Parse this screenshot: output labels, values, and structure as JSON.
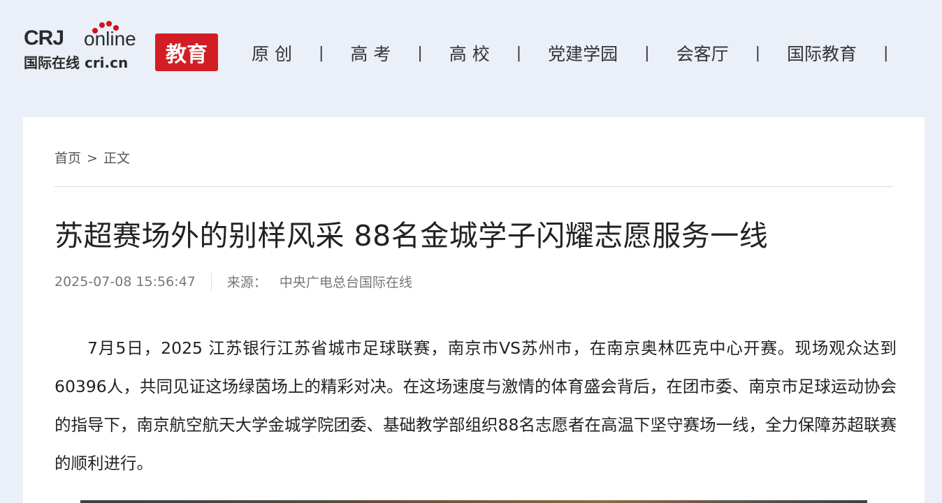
{
  "header": {
    "logo": {
      "brand": "CRJ",
      "online": "online",
      "subtitle": "国际在线 cri.cn",
      "badge": "教育"
    },
    "nav": [
      {
        "label": "原 创"
      },
      {
        "label": "高 考"
      },
      {
        "label": "高 校"
      },
      {
        "label": "党建学园"
      },
      {
        "label": "会客厅"
      },
      {
        "label": "国际教育"
      }
    ],
    "nav_separator": "|"
  },
  "breadcrumb": {
    "home": "首页",
    "separator": ">",
    "current": "正文"
  },
  "article": {
    "title": "苏超赛场外的别样风采 88名金城学子闪耀志愿服务一线",
    "datetime": "2025-07-08 15:56:47",
    "source_label": "来源：",
    "source_name": "中央广电总台国际在线",
    "paragraph": "7月5日，2025 江苏银行江苏省城市足球联赛，南京市VS苏州市，在南京奥林匹克中心开赛。现场观众达到60396人，共同见证这场绿茵场上的精彩对决。在这场速度与激情的体育盛会背后，在团市委、南京市足球运动协会的指导下，南京航空航天大学金城学院团委、基础教学部组织88名志愿者在高温下坚守赛场一线，全力保障苏超联赛的顺利进行。"
  },
  "colors": {
    "page_bg": "#eaeff8",
    "badge_red": "#d31d24",
    "card_bg": "#ffffff"
  }
}
